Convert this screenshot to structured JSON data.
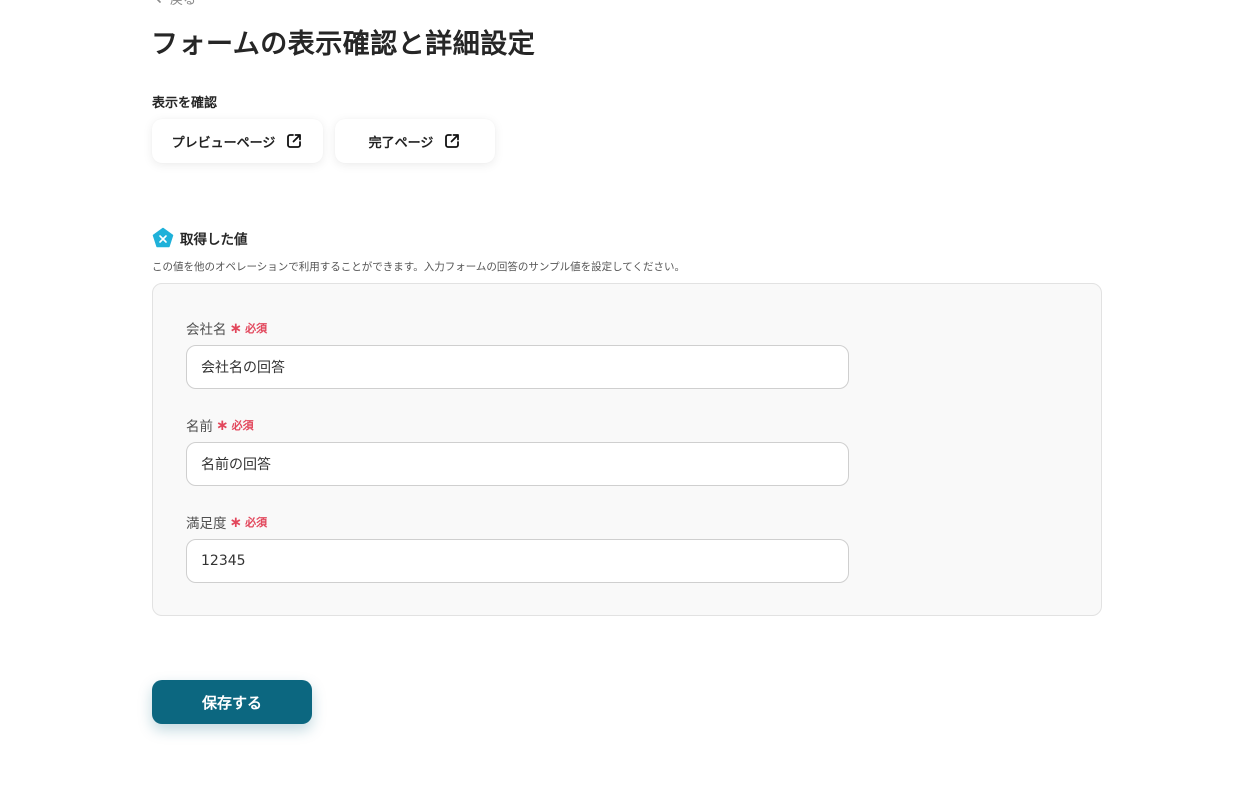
{
  "nav": {
    "back_label": "戻る"
  },
  "page": {
    "title": "フォームの表示確認と詳細設定"
  },
  "display_check": {
    "label": "表示を確認",
    "preview_button": "プレビューページ",
    "complete_button": "完了ページ"
  },
  "values": {
    "title": "取得した値",
    "description": "この値を他のオペレーションで利用することができます。入力フォームの回答のサンプル値を設定してください。",
    "icon": "yoom-pentagon-icon",
    "icon_color": "#1fb1d9"
  },
  "fields": [
    {
      "label": "会社名",
      "required_label": "必須",
      "value": "会社名の回答"
    },
    {
      "label": "名前",
      "required_label": "必須",
      "value": "名前の回答"
    },
    {
      "label": "満足度",
      "required_label": "必須",
      "value": "12345"
    }
  ],
  "actions": {
    "save_label": "保存する",
    "save_color": "#0c6780"
  },
  "colors": {
    "required": "#e2475c"
  }
}
